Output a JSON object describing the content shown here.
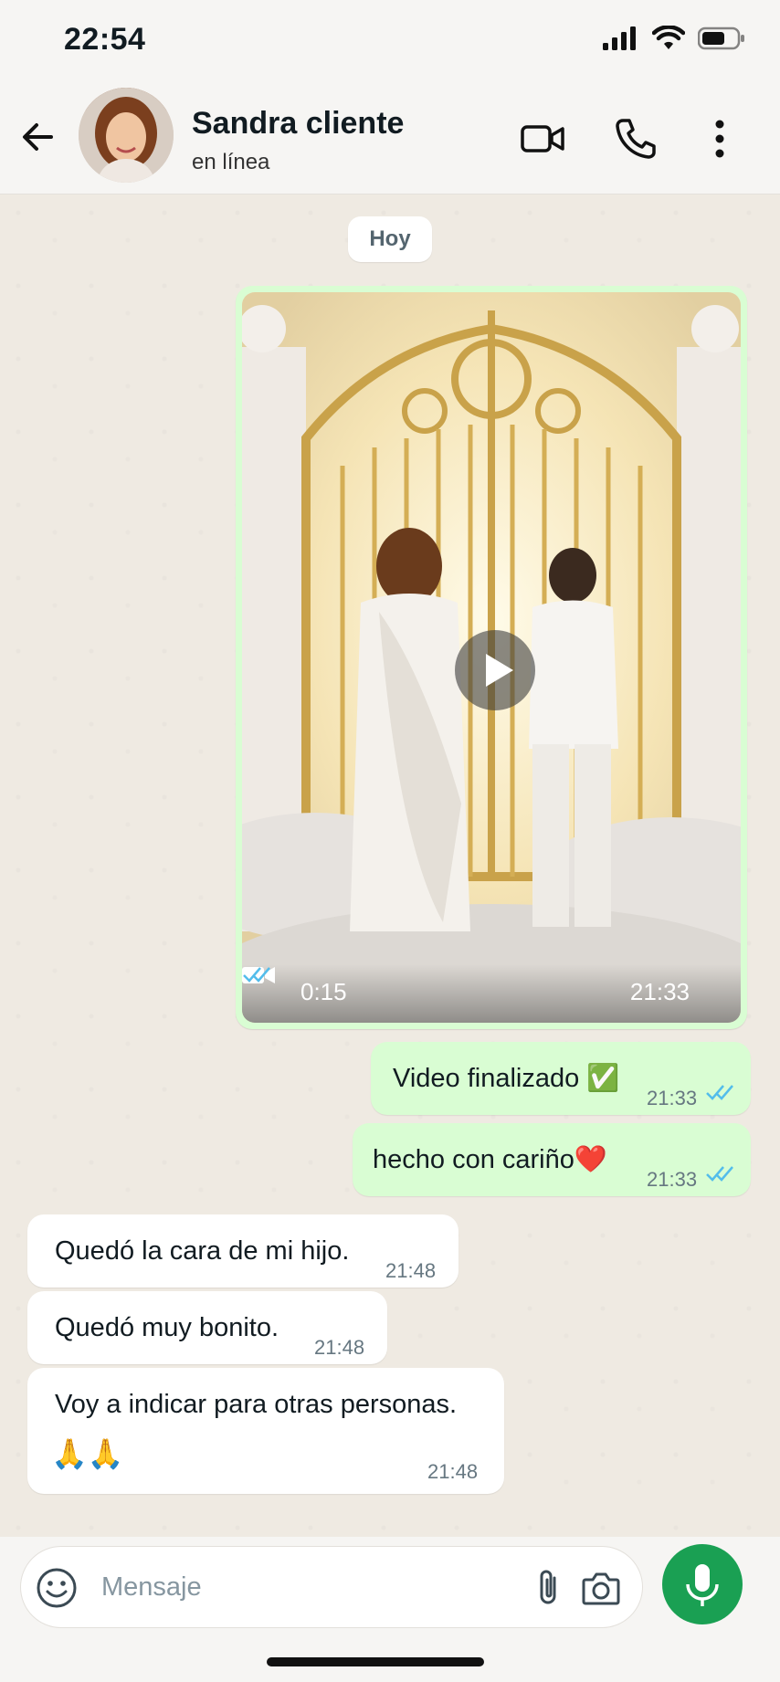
{
  "status_bar": {
    "time": "22:54"
  },
  "header": {
    "contact_name": "Sandra cliente",
    "contact_status": "en línea"
  },
  "chat": {
    "date_label": "Hoy",
    "video_message": {
      "duration": "0:15",
      "time": "21:33"
    },
    "messages": [
      {
        "text": "Video finalizado ✅",
        "time": "21:33",
        "direction": "outgoing"
      },
      {
        "text": "hecho con cariño❤️",
        "time": "21:33",
        "direction": "outgoing"
      },
      {
        "text": "Quedó la cara de mi hijo.",
        "time": "21:48",
        "direction": "incoming"
      },
      {
        "text": "Quedó muy bonito.",
        "time": "21:48",
        "direction": "incoming"
      },
      {
        "text": "Voy a indicar para otras personas.",
        "text2": "🙏🙏",
        "time": "21:48",
        "direction": "incoming"
      }
    ]
  },
  "composer": {
    "placeholder": "Mensaje"
  },
  "colors": {
    "outgoing_bubble": "#d9fdd3",
    "incoming_bubble": "#ffffff",
    "read_ticks": "#53bdeb",
    "mic_button": "#1aa053"
  }
}
